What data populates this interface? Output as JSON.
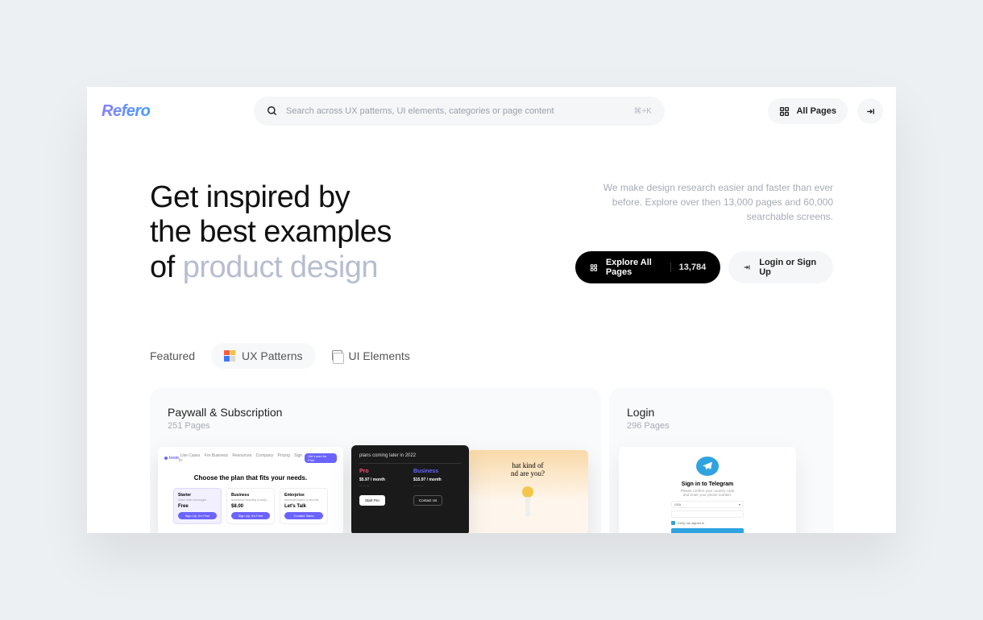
{
  "header": {
    "logo": "Refero",
    "search_placeholder": "Search across UX patterns, UI elements, categories or page content",
    "search_shortcut": "⌘+K",
    "all_pages_label": "All Pages"
  },
  "hero": {
    "title_line1": "Get inspired by",
    "title_line2": "the best examples",
    "title_line3_prefix": "of ",
    "title_line3_highlight": "product design",
    "description": "We make design research easier and faster than ever before. Explore over then 13,000 pages and 60,000 searchable screens.",
    "explore_label": "Explore All Pages",
    "explore_count": "13,784",
    "login_label": "Login or Sign Up"
  },
  "tabs": {
    "featured": "Featured",
    "ux_patterns": "UX Patterns",
    "ui_elements": "UI Elements"
  },
  "cards": {
    "paywall": {
      "title": "Paywall & Subscription",
      "subtitle": "251 Pages",
      "thumb1": {
        "brand": "loom",
        "nav": [
          "Use Cases",
          "For Business",
          "Resources",
          "Company",
          "Pricing",
          "Sign in"
        ],
        "cta": "Get Loom for Free",
        "headline": "Choose the plan that fits your needs.",
        "plans": [
          {
            "name": "Starter",
            "tagline": "Quick video messages",
            "price": "Free",
            "button": "Sign Up, It's Free"
          },
          {
            "name": "Business",
            "tagline": "Advanced recording & analytics",
            "price": "$8.00",
            "button": "Sign Up, It's Free"
          },
          {
            "name": "Enterprise",
            "tagline": "Advanced admin & security",
            "price": "Let's Talk",
            "button": "Contact Sales"
          }
        ]
      },
      "thumb2": {
        "header": "plans coming later in 2022",
        "pro": {
          "name": "Pro",
          "price": "$5.97 / month"
        },
        "business": {
          "name": "Business",
          "price": "$15.97 / month"
        },
        "btn1": "Start Pro",
        "btn2": "Contact Us"
      },
      "thumb3": {
        "headline": "hat kind of\nnd are you?"
      }
    },
    "login": {
      "title": "Login",
      "subtitle": "296 Pages",
      "thumb": {
        "title": "Sign in to Telegram",
        "subtitle": "Please confirm your country code\nand enter your phone number.",
        "country": "USA",
        "check_label": "Keep me signed in"
      }
    }
  }
}
